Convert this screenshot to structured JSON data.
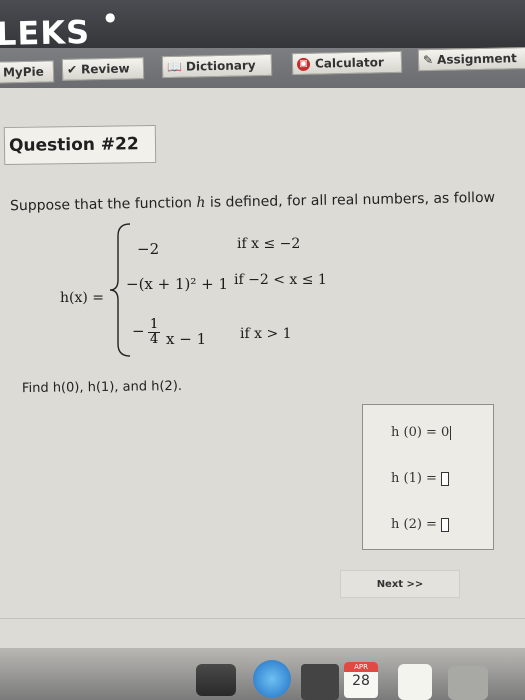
{
  "app": {
    "logo": "LEKS"
  },
  "toolbar": {
    "mypie": "MyPie",
    "review": "Review",
    "dictionary": "Dictionary",
    "calculator": "Calculator",
    "assignment": "Assignment"
  },
  "question": {
    "title": "Question #22",
    "prompt_before": "Suppose that the function ",
    "func_name": "h",
    "prompt_after": " is defined, for all real numbers, as follow",
    "lhs": "h(x) =",
    "pieces": [
      {
        "expr": "−2",
        "cond": "if x ≤ −2"
      },
      {
        "expr": "−(x + 1)² + 1",
        "cond": "if −2 < x ≤ 1"
      },
      {
        "expr_sign": "−",
        "frac_num": "1",
        "frac_den": "4",
        "expr_rest": "x − 1",
        "cond": "if x > 1"
      }
    ],
    "find_text": "Find h(0), h(1), and h(2)."
  },
  "answers": [
    {
      "label": "h (0) =",
      "value": "0"
    },
    {
      "label": "h (1) =",
      "value": ""
    },
    {
      "label": "h (2) =",
      "value": ""
    }
  ],
  "next_label": "Next >>",
  "dock": {
    "calendar_month": "APR",
    "calendar_day": "28"
  }
}
